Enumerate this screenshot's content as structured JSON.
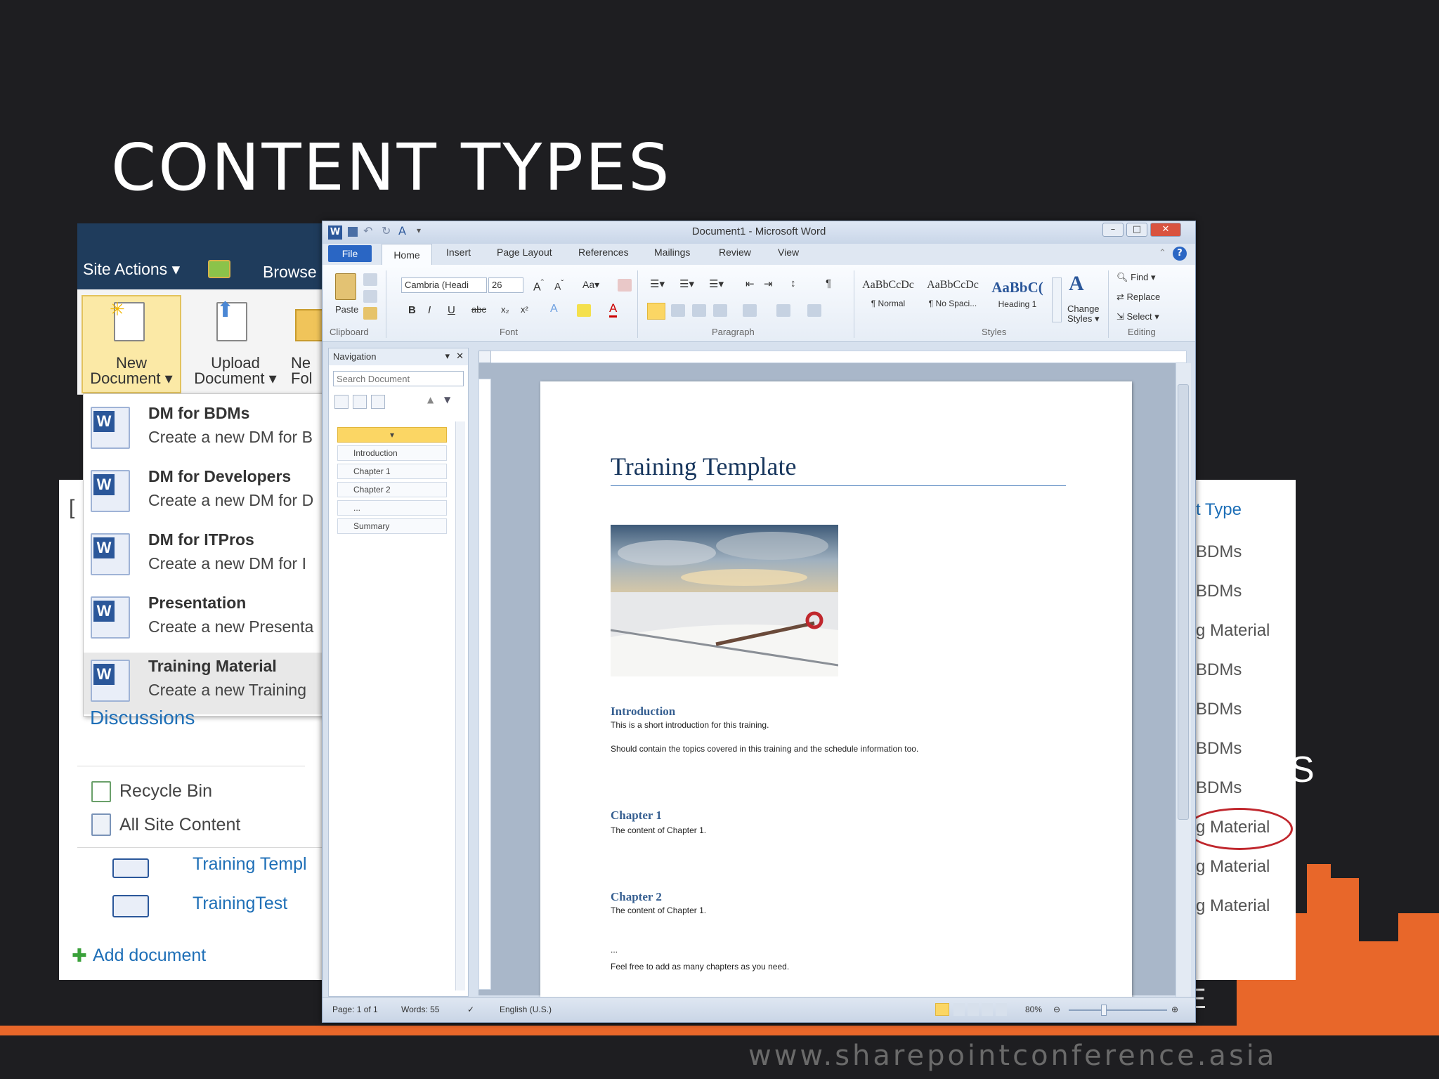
{
  "slide": {
    "title": "CONTENT TYPES",
    "footer_url": "www.sharepointconference.asia",
    "accent_color": "#e8672a"
  },
  "sharepoint": {
    "site_actions": "Site Actions ▾",
    "browse": "Browse",
    "ribbon": {
      "new_document": [
        "New",
        "Document ▾"
      ],
      "upload_document": [
        "Upload",
        "Document ▾"
      ],
      "new_folder": [
        "Ne",
        "Fol"
      ]
    },
    "new_menu": [
      {
        "title": "DM for BDMs",
        "desc": "Create a new DM for B"
      },
      {
        "title": "DM for Developers",
        "desc": "Create a new DM for D"
      },
      {
        "title": "DM for ITPros",
        "desc": "Create a new DM for I"
      },
      {
        "title": "Presentation",
        "desc": "Create a new Presenta"
      },
      {
        "title": "Training Material",
        "desc": "Create a new Training"
      }
    ],
    "left_nav": {
      "discussions": "Discussions",
      "recycle_bin": "Recycle Bin",
      "all_site_content": "All Site Content"
    },
    "documents": [
      "Training Templ",
      "TrainingTest"
    ],
    "add_document": "Add document",
    "content_type_header": "t Type",
    "content_types": [
      "BDMs",
      "BDMs",
      "g Material",
      "BDMs",
      "BDMs",
      "BDMs",
      "BDMs",
      "g Material",
      "g Material",
      "g Material"
    ],
    "stray_left": "[",
    "stray_right": "S",
    "stray_e": "E"
  },
  "word": {
    "window_title": "Document1 - Microsoft Word",
    "tabs": [
      "File",
      "Home",
      "Insert",
      "Page Layout",
      "References",
      "Mailings",
      "Review",
      "View"
    ],
    "clipboard": {
      "paste": "Paste",
      "label": "Clipboard"
    },
    "font": {
      "name": "Cambria (Headi",
      "size": "26",
      "label": "Font"
    },
    "paragraph_label": "Paragraph",
    "styles": [
      {
        "sample": "AaBbCcDc",
        "name": "¶ Normal"
      },
      {
        "sample": "AaBbCcDc",
        "name": "¶ No Spaci..."
      },
      {
        "sample": "AaBbC(",
        "name": "Heading 1"
      }
    ],
    "change_styles": [
      "Change",
      "Styles ▾"
    ],
    "styles_label": "Styles",
    "editing": {
      "find": "Find ▾",
      "replace": "Replace",
      "select": "Select ▾",
      "label": "Editing"
    },
    "navigation": {
      "title": "Navigation",
      "search_placeholder": "Search Document",
      "items": [
        "Introduction",
        "Chapter 1",
        "Chapter 2",
        "...",
        "Summary"
      ]
    },
    "document": {
      "title": "Training Template",
      "sections": [
        {
          "heading": "Introduction",
          "lines": [
            "This is a short introduction for this training.",
            "Should contain the topics covered in this training and the schedule information too."
          ]
        },
        {
          "heading": "Chapter 1",
          "lines": [
            "The content of Chapter 1."
          ]
        },
        {
          "heading": "Chapter 2",
          "lines": [
            "The content of Chapter 1."
          ]
        }
      ],
      "ellipsis": "...",
      "closing": "Feel free to add as many chapters as you need."
    },
    "status": {
      "page": "Page: 1 of 1",
      "words": "Words: 55",
      "language": "English (U.S.)",
      "zoom": "80%"
    }
  }
}
